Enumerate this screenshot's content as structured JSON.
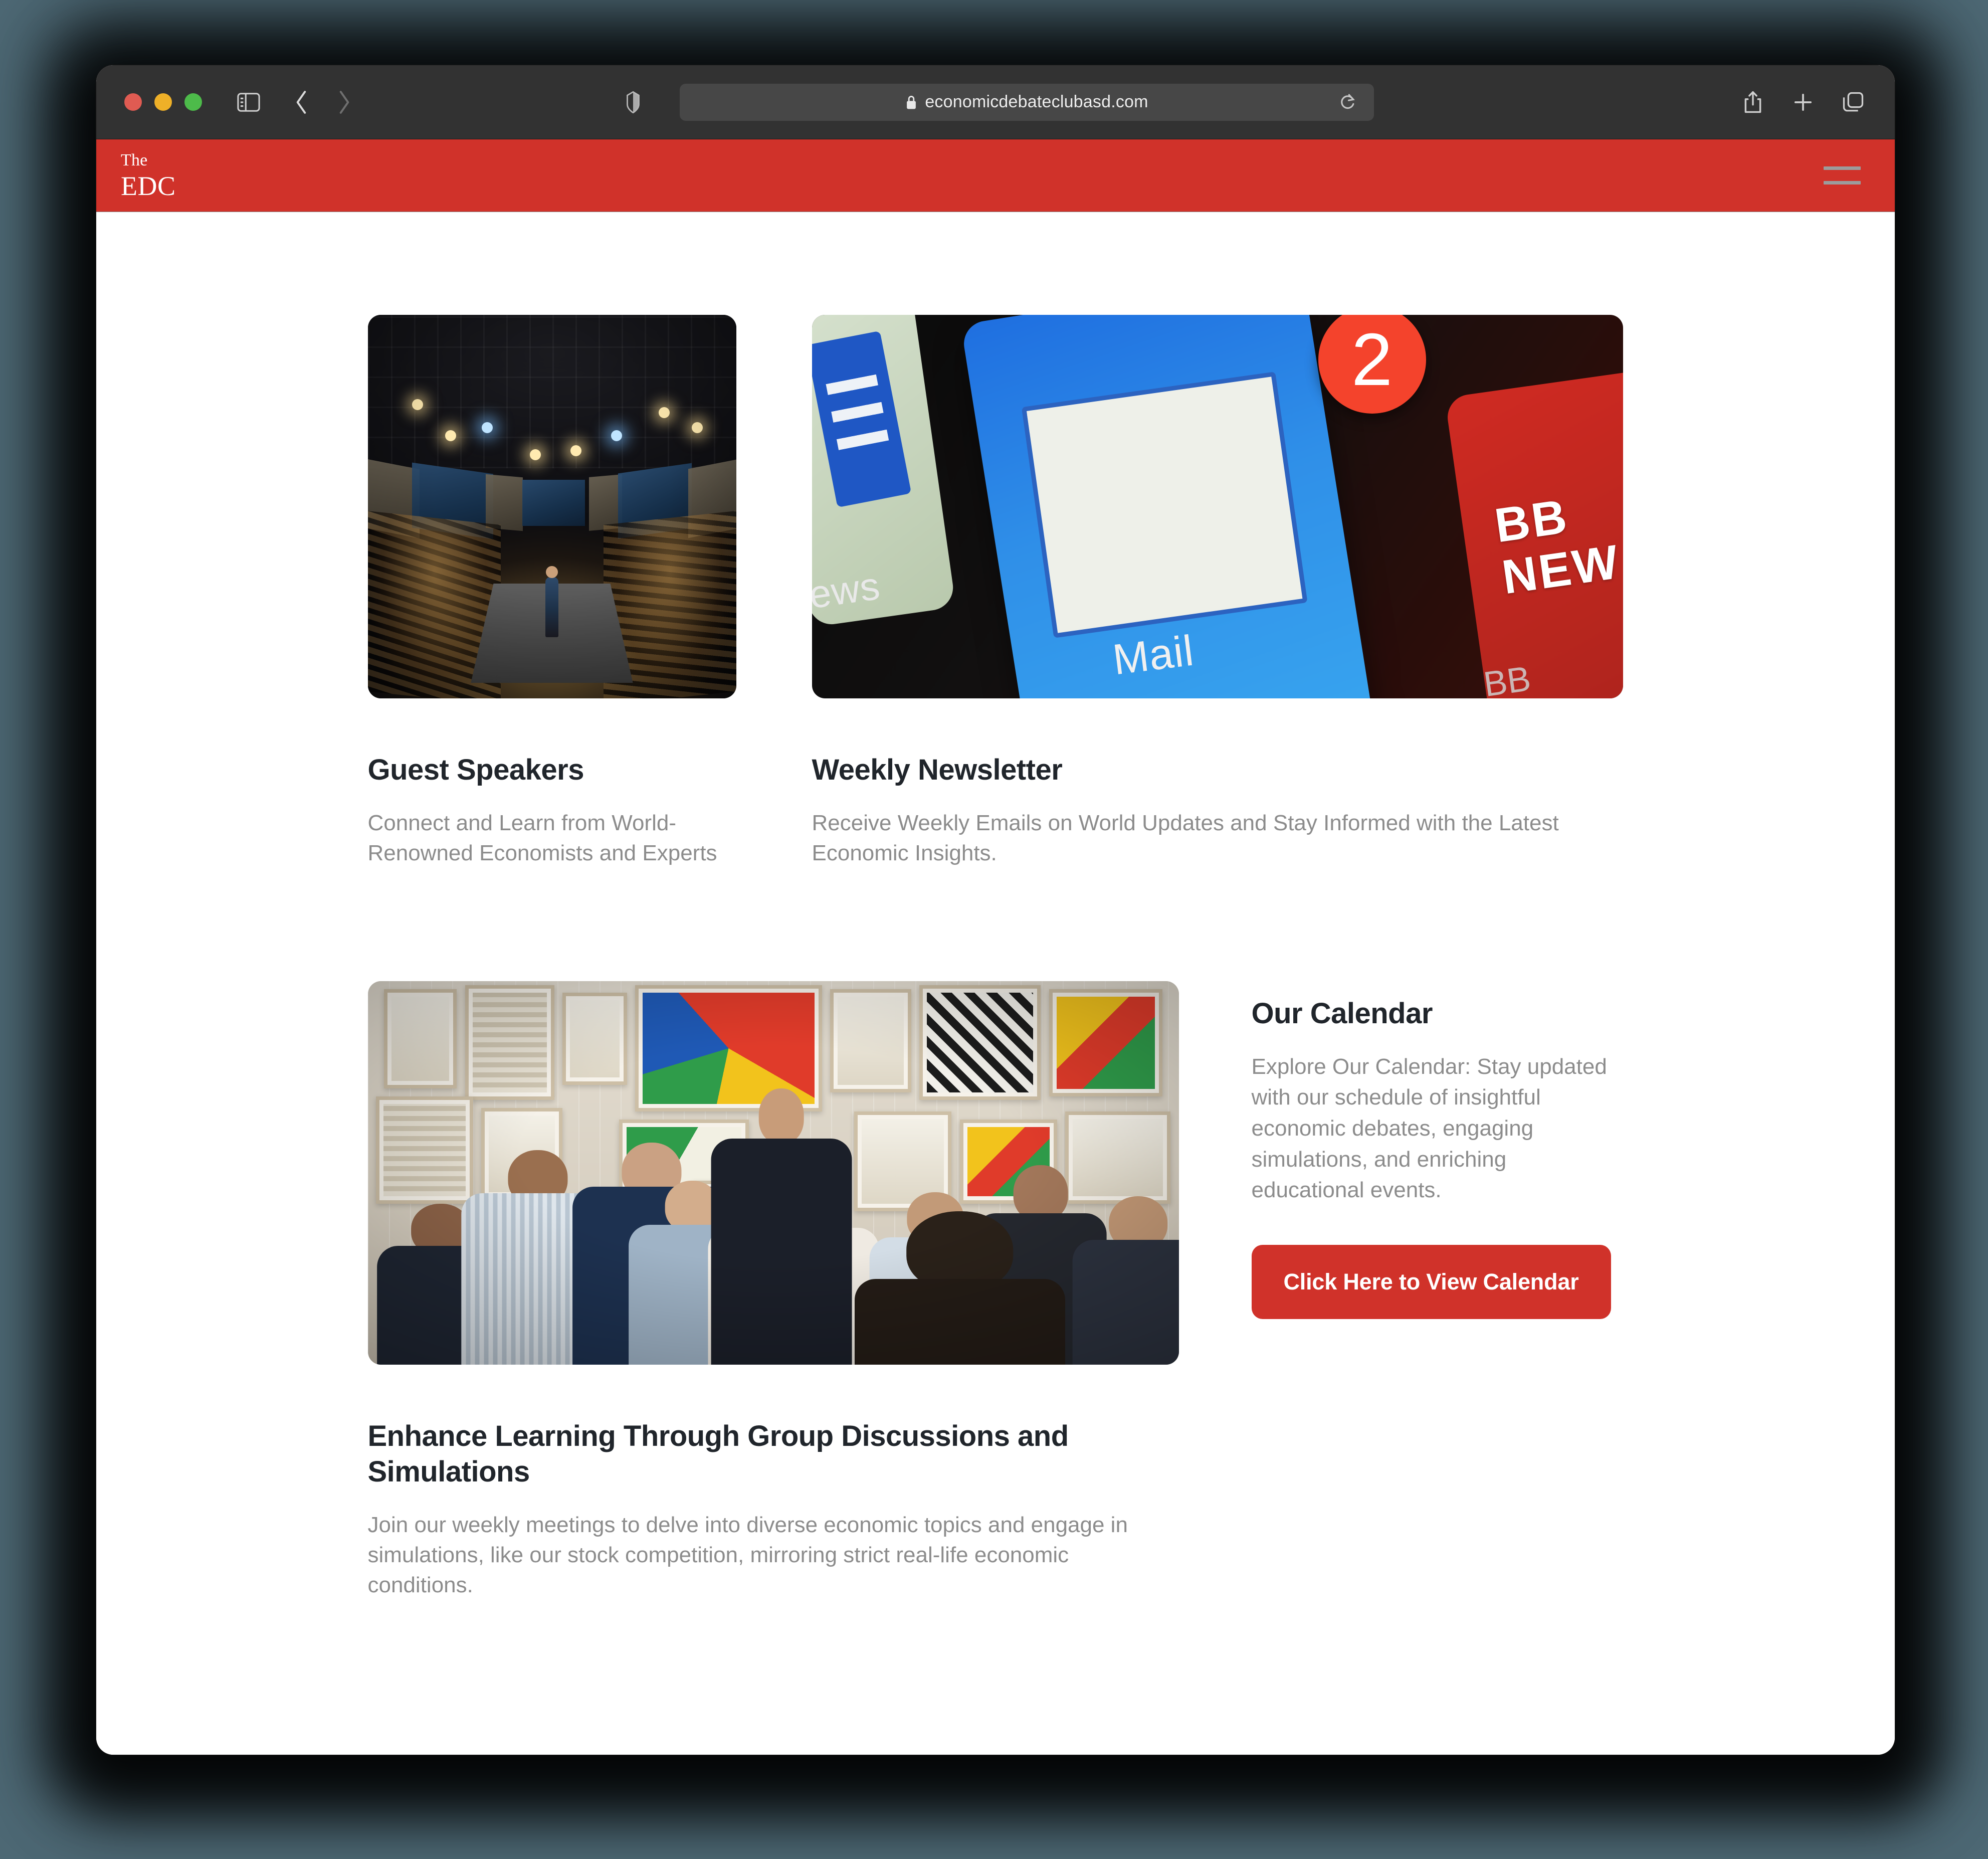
{
  "browser": {
    "url": "economicdebateclubasd.com",
    "icons": {
      "sidebar": "sidebar-toggle-icon",
      "back": "back-arrow-icon",
      "forward": "forward-arrow-icon",
      "shield": "privacy-shield-icon",
      "lock": "lock-icon",
      "reload": "reload-icon",
      "share": "share-icon",
      "new_tab": "plus-icon",
      "tabs": "tab-overview-icon"
    },
    "traffic_lights": [
      "close",
      "minimize",
      "maximize"
    ]
  },
  "site": {
    "logo_line1": "The",
    "logo_line2": "EDC",
    "menu_label": "hamburger-menu",
    "header_color": "#d0322a"
  },
  "cards": {
    "speakers": {
      "title": "Guest Speakers",
      "body": "Connect and Learn from World-Renowned Economists and Experts",
      "image_alt": "auditorium-speaker-photo"
    },
    "newsletter": {
      "title": "Weekly Newsletter",
      "body": "Receive Weekly Emails on World Updates and Stay Informed with the Latest Economic Insights.",
      "image_alt": "phone-mail-app-photo",
      "photo_labels": {
        "news": "ews",
        "mail": "Mail",
        "badge_count": "2",
        "bbc_line1": "BB",
        "bbc_line2": "NEW",
        "bbc_bottom": "BB"
      }
    },
    "discussion": {
      "title": "Enhance Learning Through Group Discussions and Simulations",
      "body": "Join our weekly meetings to delve into diverse economic topics and engage in simulations, like our stock competition, mirroring strict real-life economic conditions.",
      "image_alt": "group-discussion-gallery-photo"
    },
    "calendar": {
      "title": "Our Calendar",
      "body": "Explore Our Calendar: Stay updated with our schedule of insightful economic debates, engaging simulations, and enriching educational events.",
      "cta_label": "Click Here to View Calendar",
      "cta_color": "#d0322a"
    }
  }
}
